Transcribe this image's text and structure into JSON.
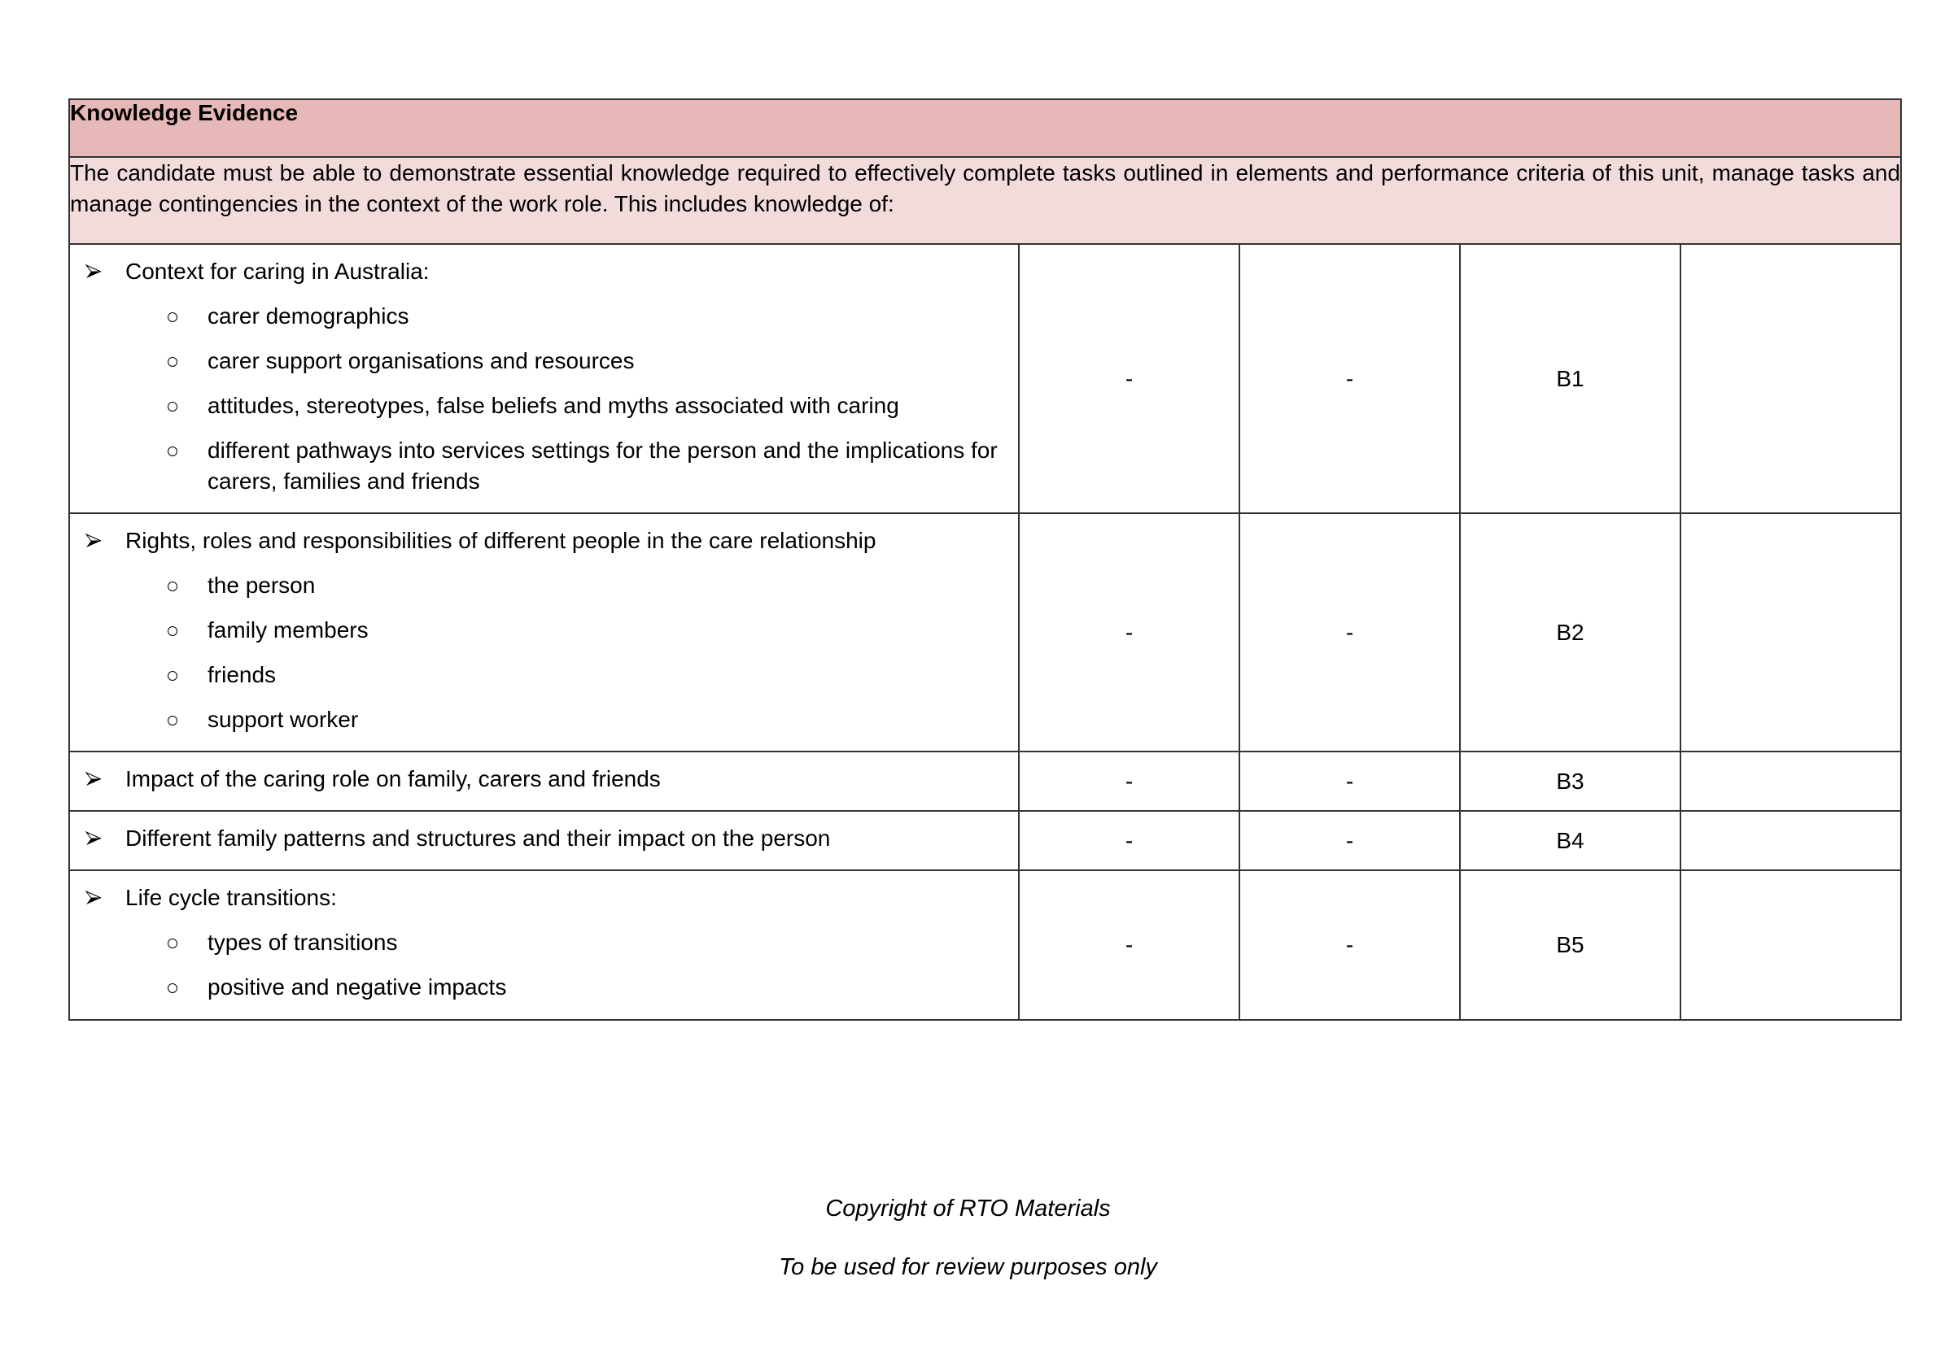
{
  "table": {
    "title": "Knowledge Evidence",
    "intro": "The candidate must be able to demonstrate essential knowledge required to effectively complete tasks outlined in elements and performance criteria of this unit, manage tasks and manage contingencies in the context of the work role. This includes knowledge of:",
    "rows": [
      {
        "topic": "Context for caring in Australia:",
        "subitems": [
          "carer demographics",
          "carer support organisations and resources",
          "attitudes, stereotypes, false beliefs and myths associated with caring",
          "different pathways into services settings for the person and the implications for carers, families and friends"
        ],
        "col1": "-",
        "col2": "-",
        "col3": "B1",
        "col4": ""
      },
      {
        "topic": "Rights, roles and responsibilities of different people in the care relationship",
        "subitems": [
          "the person",
          "family members",
          "friends",
          "support worker"
        ],
        "col1": "-",
        "col2": "-",
        "col3": "B2",
        "col4": ""
      },
      {
        "topic": "Impact of the caring role on family, carers and friends",
        "subitems": [],
        "col1": "-",
        "col2": "-",
        "col3": "B3",
        "col4": ""
      },
      {
        "topic": "Different family patterns and structures and their impact on the person",
        "subitems": [],
        "col1": "-",
        "col2": "-",
        "col3": "B4",
        "col4": ""
      },
      {
        "topic": "Life cycle transitions:",
        "subitems": [
          "types of transitions",
          "positive and negative impacts"
        ],
        "col1": "-",
        "col2": "-",
        "col3": "B5",
        "col4": ""
      }
    ]
  },
  "footer": {
    "copyright": "Copyright of RTO Materials",
    "notice": "To be used for review purposes only"
  },
  "colors": {
    "header_bg": "#e6b8b7",
    "intro_bg": "#f2dcdb",
    "border": "#333333"
  }
}
